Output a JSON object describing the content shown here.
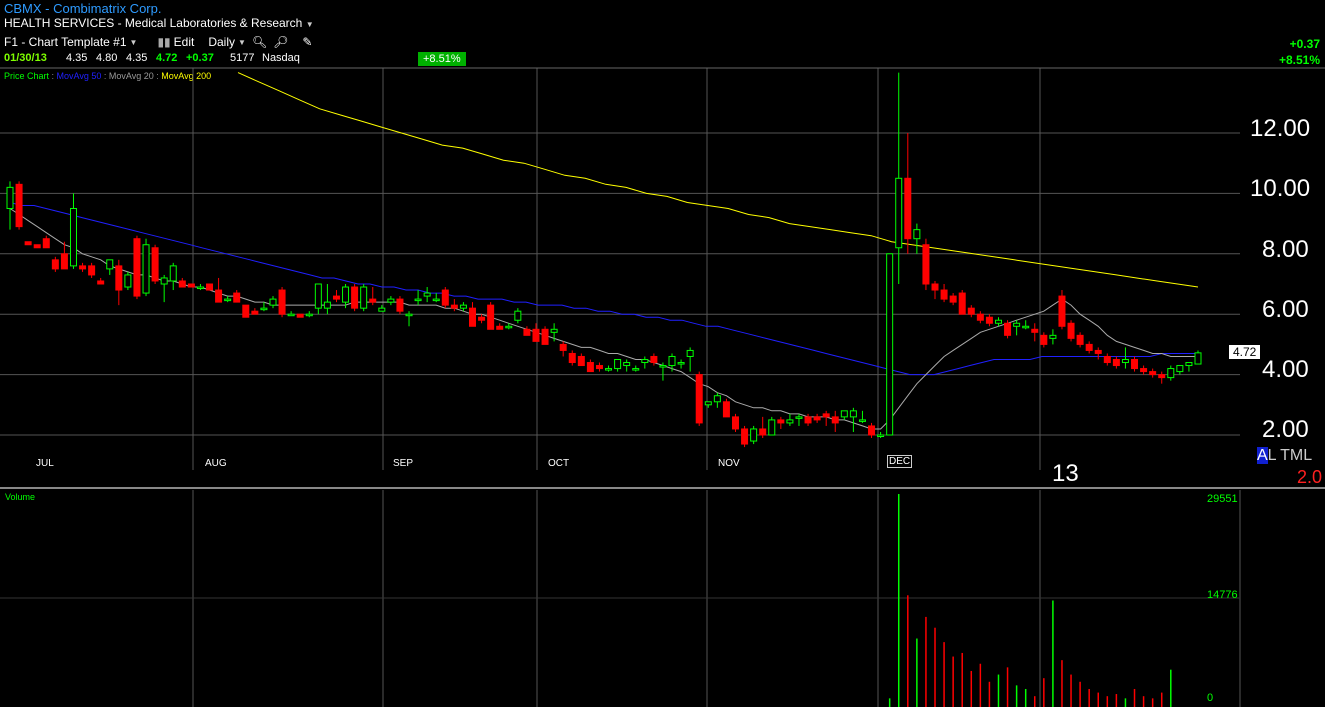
{
  "header": {
    "ticker_line": "CBMX - Combimatrix Corp.",
    "sector_line": "HEALTH SERVICES - Medical Laboratories & Research"
  },
  "toolbar": {
    "template_label": "F1 - Chart Template #1",
    "edit_label": "Edit",
    "period_label": "Daily"
  },
  "quote": {
    "date": "01/30/13",
    "open": "4.35",
    "high": "4.80",
    "low": "4.35",
    "last": "4.72",
    "change": "+0.37",
    "volume": "5177",
    "exchange": "Nasdaq",
    "pct_box": "+8.51%"
  },
  "top_right": {
    "change": "+0.37",
    "pct": "+8.51%"
  },
  "legend": {
    "price_chart": "Price Chart",
    "ma50": "MovAvg 50",
    "ma20": "MovAvg 20",
    "ma200": "MovAvg 200",
    "colors": {
      "price": "#00ff00",
      "ma50": "#2020ff",
      "ma20": "#aaaaaa",
      "ma200": "#ffff00"
    }
  },
  "price_axis": [
    "12.00",
    "10.00",
    "8.00",
    "6.00",
    "4.00",
    "2.00"
  ],
  "months": [
    "JUL",
    "AUG",
    "SEP",
    "OCT",
    "NOV",
    "DEC"
  ],
  "year_label": "13",
  "price_tag": "4.72",
  "corner": {
    "al": "A",
    "rest": "L TML",
    "red": "2.0"
  },
  "volume_panel": {
    "label": "Volume",
    "ticks": [
      "29551",
      "14776",
      "0"
    ]
  },
  "chart_data": {
    "type": "candlestick",
    "ylim": [
      1.0,
      14.0
    ],
    "up_color": "#00ff00",
    "down_color": "#ff0000",
    "candles": [
      [
        9.5,
        10.4,
        8.8,
        10.2
      ],
      [
        10.3,
        10.4,
        8.8,
        8.9
      ],
      [
        8.4,
        8.4,
        8.3,
        8.3
      ],
      [
        8.3,
        8.3,
        8.2,
        8.2
      ],
      [
        8.5,
        8.6,
        8.2,
        8.2
      ],
      [
        7.8,
        7.9,
        7.4,
        7.5
      ],
      [
        8.0,
        8.4,
        7.5,
        7.5
      ],
      [
        7.6,
        10.0,
        7.5,
        9.5
      ],
      [
        7.6,
        7.7,
        7.4,
        7.5
      ],
      [
        7.6,
        7.7,
        7.2,
        7.3
      ],
      [
        7.1,
        7.2,
        7.0,
        7.0
      ],
      [
        7.5,
        7.8,
        7.3,
        7.8
      ],
      [
        7.6,
        7.8,
        6.3,
        6.8
      ],
      [
        6.9,
        7.4,
        6.8,
        7.3
      ],
      [
        8.5,
        8.6,
        6.5,
        6.6
      ],
      [
        6.7,
        8.5,
        6.6,
        8.3
      ],
      [
        8.2,
        8.3,
        7.0,
        7.1
      ],
      [
        7.0,
        7.3,
        6.4,
        7.2
      ],
      [
        7.1,
        7.7,
        6.8,
        7.6
      ],
      [
        7.1,
        7.2,
        6.9,
        6.9
      ],
      [
        7.0,
        7.0,
        6.9,
        6.9
      ],
      [
        6.9,
        7.0,
        6.8,
        6.9
      ],
      [
        7.0,
        7.0,
        6.8,
        6.8
      ],
      [
        6.8,
        7.2,
        6.4,
        6.4
      ],
      [
        6.5,
        6.6,
        6.4,
        6.5
      ],
      [
        6.7,
        6.8,
        6.4,
        6.4
      ],
      [
        6.3,
        6.3,
        5.9,
        5.9
      ],
      [
        6.1,
        6.2,
        6.0,
        6.0
      ],
      [
        6.2,
        6.4,
        6.1,
        6.2
      ],
      [
        6.3,
        6.6,
        6.2,
        6.5
      ],
      [
        6.8,
        6.9,
        5.9,
        6.0
      ],
      [
        6.0,
        6.1,
        6.0,
        6.0
      ],
      [
        6.0,
        6.0,
        5.9,
        5.9
      ],
      [
        6.0,
        6.1,
        5.9,
        6.0
      ],
      [
        6.2,
        7.0,
        6.0,
        7.0
      ],
      [
        6.2,
        7.0,
        6.0,
        6.4
      ],
      [
        6.6,
        6.8,
        6.4,
        6.5
      ],
      [
        6.4,
        7.0,
        6.2,
        6.9
      ],
      [
        6.9,
        7.0,
        6.1,
        6.2
      ],
      [
        6.2,
        7.0,
        6.1,
        6.9
      ],
      [
        6.5,
        6.9,
        6.3,
        6.4
      ],
      [
        6.1,
        6.3,
        6.1,
        6.2
      ],
      [
        6.4,
        6.6,
        6.3,
        6.5
      ],
      [
        6.5,
        6.6,
        6.0,
        6.1
      ],
      [
        6.0,
        6.1,
        5.6,
        6.0
      ],
      [
        6.5,
        6.8,
        6.3,
        6.5
      ],
      [
        6.6,
        6.9,
        6.4,
        6.7
      ],
      [
        6.5,
        6.7,
        6.4,
        6.5
      ],
      [
        6.8,
        6.9,
        6.2,
        6.3
      ],
      [
        6.3,
        6.5,
        6.1,
        6.2
      ],
      [
        6.2,
        6.4,
        6.1,
        6.3
      ],
      [
        6.2,
        6.4,
        5.6,
        5.6
      ],
      [
        5.9,
        6.0,
        5.7,
        5.8
      ],
      [
        6.3,
        6.4,
        5.5,
        5.5
      ],
      [
        5.6,
        5.7,
        5.5,
        5.5
      ],
      [
        5.6,
        5.7,
        5.5,
        5.6
      ],
      [
        5.8,
        6.2,
        5.7,
        6.1
      ],
      [
        5.5,
        5.6,
        5.3,
        5.3
      ],
      [
        5.5,
        5.7,
        5.1,
        5.1
      ],
      [
        5.5,
        5.6,
        5.0,
        5.0
      ],
      [
        5.4,
        5.7,
        5.1,
        5.5
      ],
      [
        5.0,
        5.1,
        4.6,
        4.8
      ],
      [
        4.7,
        4.8,
        4.3,
        4.4
      ],
      [
        4.6,
        4.7,
        4.3,
        4.3
      ],
      [
        4.4,
        4.5,
        4.1,
        4.1
      ],
      [
        4.3,
        4.4,
        4.1,
        4.2
      ],
      [
        4.2,
        4.3,
        4.1,
        4.2
      ],
      [
        4.2,
        4.5,
        4.1,
        4.5
      ],
      [
        4.3,
        4.5,
        4.1,
        4.4
      ],
      [
        4.2,
        4.3,
        4.1,
        4.2
      ],
      [
        4.4,
        4.6,
        4.2,
        4.5
      ],
      [
        4.6,
        4.7,
        4.3,
        4.4
      ],
      [
        4.3,
        4.4,
        3.8,
        4.3
      ],
      [
        4.3,
        4.7,
        4.1,
        4.6
      ],
      [
        4.4,
        4.5,
        4.2,
        4.4
      ],
      [
        4.6,
        4.9,
        4.1,
        4.8
      ],
      [
        4.0,
        4.1,
        2.3,
        2.4
      ],
      [
        3.0,
        3.1,
        2.9,
        3.1
      ],
      [
        3.1,
        3.4,
        2.9,
        3.3
      ],
      [
        3.1,
        3.2,
        2.6,
        2.6
      ],
      [
        2.6,
        2.7,
        2.1,
        2.2
      ],
      [
        2.2,
        2.3,
        1.6,
        1.7
      ],
      [
        1.8,
        2.3,
        1.7,
        2.2
      ],
      [
        2.2,
        2.6,
        1.9,
        2.0
      ],
      [
        2.0,
        2.6,
        2.0,
        2.5
      ],
      [
        2.5,
        2.6,
        2.2,
        2.4
      ],
      [
        2.4,
        2.7,
        2.3,
        2.5
      ],
      [
        2.6,
        2.7,
        2.3,
        2.6
      ],
      [
        2.6,
        2.7,
        2.3,
        2.4
      ],
      [
        2.6,
        2.7,
        2.4,
        2.5
      ],
      [
        2.7,
        2.8,
        2.3,
        2.6
      ],
      [
        2.6,
        2.8,
        2.1,
        2.4
      ],
      [
        2.6,
        2.8,
        2.5,
        2.8
      ],
      [
        2.6,
        2.9,
        2.1,
        2.8
      ],
      [
        2.5,
        2.8,
        2.4,
        2.5
      ],
      [
        2.3,
        2.4,
        1.9,
        2.0
      ],
      [
        2.0,
        2.1,
        1.9,
        2.0
      ],
      [
        2.0,
        8.0,
        2.0,
        8.0
      ],
      [
        8.2,
        14.0,
        7.0,
        10.5
      ],
      [
        10.5,
        12.0,
        8.0,
        8.5
      ],
      [
        8.5,
        9.0,
        8.0,
        8.8
      ],
      [
        8.3,
        8.5,
        6.8,
        7.0
      ],
      [
        7.0,
        7.1,
        6.5,
        6.8
      ],
      [
        6.8,
        7.0,
        6.4,
        6.5
      ],
      [
        6.6,
        6.7,
        6.3,
        6.4
      ],
      [
        6.7,
        6.8,
        6.0,
        6.0
      ],
      [
        6.2,
        6.3,
        5.9,
        6.0
      ],
      [
        6.0,
        6.1,
        5.7,
        5.8
      ],
      [
        5.9,
        6.0,
        5.6,
        5.7
      ],
      [
        5.7,
        5.9,
        5.6,
        5.8
      ],
      [
        5.7,
        5.8,
        5.2,
        5.3
      ],
      [
        5.6,
        5.8,
        5.3,
        5.7
      ],
      [
        5.6,
        5.8,
        5.5,
        5.6
      ],
      [
        5.5,
        5.7,
        5.1,
        5.4
      ],
      [
        5.3,
        5.4,
        4.9,
        5.0
      ],
      [
        5.2,
        5.5,
        5.0,
        5.3
      ],
      [
        6.6,
        6.8,
        5.5,
        5.6
      ],
      [
        5.7,
        5.8,
        5.1,
        5.2
      ],
      [
        5.3,
        5.4,
        4.9,
        5.0
      ],
      [
        5.0,
        5.1,
        4.7,
        4.8
      ],
      [
        4.8,
        4.9,
        4.5,
        4.7
      ],
      [
        4.6,
        4.7,
        4.3,
        4.4
      ],
      [
        4.5,
        4.6,
        4.2,
        4.3
      ],
      [
        4.4,
        4.9,
        4.2,
        4.5
      ],
      [
        4.5,
        4.6,
        4.1,
        4.2
      ],
      [
        4.2,
        4.3,
        4.0,
        4.1
      ],
      [
        4.1,
        4.2,
        3.9,
        4.0
      ],
      [
        4.0,
        4.1,
        3.7,
        3.9
      ],
      [
        3.9,
        4.3,
        3.8,
        4.2
      ],
      [
        4.1,
        4.3,
        4.0,
        4.3
      ],
      [
        4.3,
        4.4,
        4.1,
        4.4
      ],
      [
        4.35,
        4.8,
        4.35,
        4.72
      ]
    ],
    "ma20": [
      9.5,
      9.3,
      9.1,
      8.9,
      8.7,
      8.5,
      8.3,
      8.2,
      8.0,
      7.9,
      7.8,
      7.6,
      7.5,
      7.4,
      7.3,
      7.3,
      7.2,
      7.1,
      7.1,
      7.0,
      6.9,
      6.9,
      6.8,
      6.7,
      6.6,
      6.6,
      6.5,
      6.4,
      6.4,
      6.3,
      6.3,
      6.3,
      6.3,
      6.3,
      6.3,
      6.3,
      6.3,
      6.3,
      6.4,
      6.4,
      6.4,
      6.4,
      6.4,
      6.4,
      6.3,
      6.3,
      6.3,
      6.3,
      6.2,
      6.2,
      6.1,
      6.0,
      6.0,
      5.9,
      5.8,
      5.7,
      5.6,
      5.5,
      5.4,
      5.3,
      5.2,
      5.1,
      5.0,
      4.9,
      4.9,
      4.8,
      4.7,
      4.7,
      4.6,
      4.5,
      4.5,
      4.4,
      4.3,
      4.2,
      4.1,
      3.9,
      3.7,
      3.6,
      3.4,
      3.3,
      3.1,
      3.0,
      2.9,
      2.9,
      2.8,
      2.8,
      2.7,
      2.7,
      2.6,
      2.6,
      2.6,
      2.5,
      2.5,
      2.4,
      2.3,
      2.2,
      2.2,
      2.5,
      2.9,
      3.3,
      3.7,
      4.0,
      4.3,
      4.6,
      4.8,
      5.0,
      5.2,
      5.4,
      5.5,
      5.6,
      5.7,
      5.8,
      5.9,
      6.0,
      6.1,
      6.3,
      6.5,
      6.3,
      6.0,
      5.8,
      5.6,
      5.3,
      5.1,
      5.0,
      4.9,
      4.8,
      4.7,
      4.7,
      4.6,
      4.6,
      4.6,
      4.6
    ],
    "ma50": [
      9.7,
      9.6,
      9.6,
      9.5,
      9.4,
      9.3,
      9.2,
      9.1,
      9.0,
      8.9,
      8.8,
      8.7,
      8.6,
      8.5,
      8.4,
      8.3,
      8.2,
      8.1,
      8.0,
      7.9,
      7.8,
      7.7,
      7.6,
      7.5,
      7.4,
      7.3,
      7.2,
      7.2,
      7.1,
      7.0,
      7.0,
      6.9,
      6.9,
      6.8,
      6.8,
      6.7,
      6.7,
      6.6,
      6.6,
      6.5,
      6.5,
      6.5,
      6.4,
      6.4,
      6.3,
      6.3,
      6.3,
      6.2,
      6.2,
      6.1,
      6.1,
      6.0,
      6.0,
      5.9,
      5.9,
      5.8,
      5.8,
      5.7,
      5.6,
      5.6,
      5.5,
      5.4,
      5.3,
      5.2,
      5.1,
      5.0,
      4.9,
      4.8,
      4.7,
      4.6,
      4.5,
      4.4,
      4.3,
      4.2,
      4.1,
      4.0,
      4.0,
      4.0,
      4.1,
      4.2,
      4.3,
      4.4,
      4.5,
      4.5,
      4.5,
      4.5,
      4.6,
      4.6,
      4.6,
      4.6,
      4.6,
      4.6,
      4.6,
      4.6,
      4.6,
      4.6,
      4.7,
      4.7,
      4.7,
      4.7
    ],
    "ma200": [
      14.0,
      13.7,
      13.4,
      13.1,
      12.8,
      12.6,
      12.4,
      12.2,
      12.0,
      11.8,
      11.6,
      11.5,
      11.3,
      11.1,
      11.0,
      10.8,
      10.6,
      10.5,
      10.3,
      10.2,
      10.0,
      9.9,
      9.7,
      9.6,
      9.5,
      9.3,
      9.2,
      9.0,
      8.9,
      8.8,
      8.7,
      8.6,
      8.4,
      8.3,
      8.2,
      8.1,
      8.0,
      7.9,
      7.8,
      7.7,
      7.6,
      7.5,
      7.4,
      7.3,
      7.2,
      7.1,
      7.0,
      6.9
    ],
    "volume": [
      0,
      0,
      0,
      0,
      0,
      0,
      0,
      0,
      0,
      0,
      0,
      0,
      0,
      0,
      0,
      0,
      0,
      0,
      0,
      0,
      0,
      0,
      0,
      0,
      0,
      0,
      0,
      0,
      0,
      0,
      0,
      0,
      0,
      0,
      0,
      0,
      0,
      0,
      0,
      0,
      0,
      0,
      0,
      0,
      0,
      0,
      0,
      0,
      0,
      0,
      0,
      0,
      0,
      0,
      0,
      0,
      0,
      0,
      0,
      0,
      0,
      0,
      0,
      0,
      0,
      0,
      0,
      0,
      0,
      0,
      0,
      0,
      0,
      0,
      0,
      0,
      0,
      0,
      0,
      0,
      0,
      0,
      0,
      0,
      0,
      0,
      0,
      0,
      0,
      0,
      0,
      0,
      0,
      0,
      0,
      0,
      0,
      1200,
      29551,
      15500,
      9500,
      12500,
      11000,
      9000,
      7000,
      7500,
      5000,
      6000,
      3500,
      4500,
      5500,
      3000,
      2500,
      1500,
      4000,
      14776,
      6500,
      4500,
      3500,
      2500,
      2000,
      1500,
      1800,
      1200,
      2500,
      1500,
      1200,
      2000,
      5177
    ]
  }
}
